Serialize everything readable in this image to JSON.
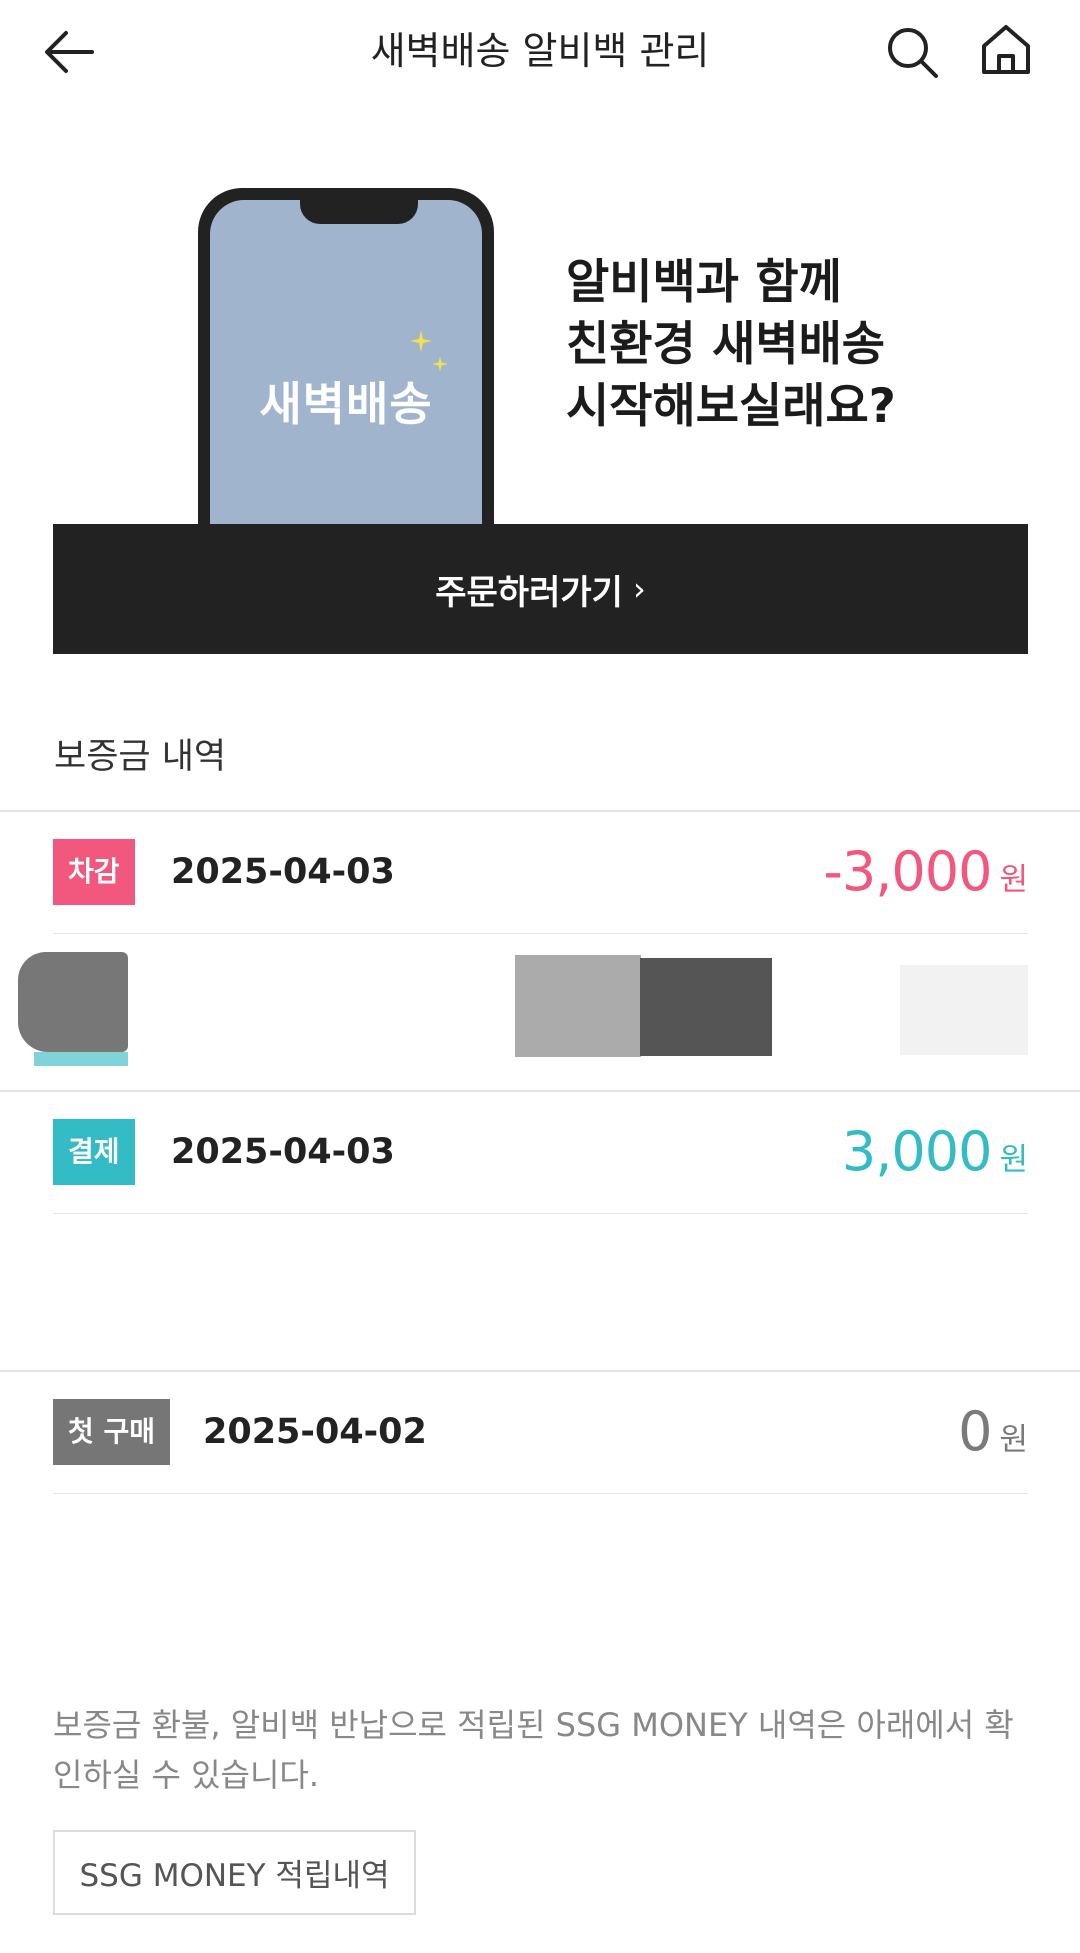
{
  "header": {
    "title": "새벽배송 알비백 관리",
    "back_icon": "arrow-left-icon",
    "search_icon": "search-icon",
    "home_icon": "home-icon"
  },
  "promo": {
    "phone_logo": "새벽배송",
    "copy_lines": [
      "알비백과 함께",
      "친환경 새벽배송",
      "시작해보실래요?"
    ],
    "order_button": "주문하러가기",
    "order_button_icon": "chevron-right-icon"
  },
  "deposit": {
    "section_title": "보증금 내역",
    "rows": [
      {
        "badge": "차감",
        "badge_color": "#f2577d",
        "date": "2025-04-03",
        "amount": "-3,000",
        "unit": "원",
        "amount_color": "#f2577d"
      },
      {
        "badge": "결제",
        "badge_color": "#34bcc6",
        "date": "2025-04-03",
        "amount": "3,000",
        "unit": "원",
        "amount_color": "#34bcc6"
      },
      {
        "badge": "첫 구매",
        "badge_color": "#767676",
        "date": "2025-04-02",
        "amount": "0",
        "unit": "원",
        "amount_color": "#7a7a7a"
      }
    ]
  },
  "footer": {
    "notice": "보증금 환불, 알비백 반납으로 적립된 SSG MONEY 내역은 아래에서 확인하실 수 있습니다.",
    "ssg_button": "SSG MONEY 적립내역"
  },
  "colors": {
    "dark": "#222222",
    "accent_pink": "#f2577d",
    "accent_teal": "#34bcc6",
    "badge_gray": "#767676",
    "phone_screen": "#a1b4cd"
  }
}
